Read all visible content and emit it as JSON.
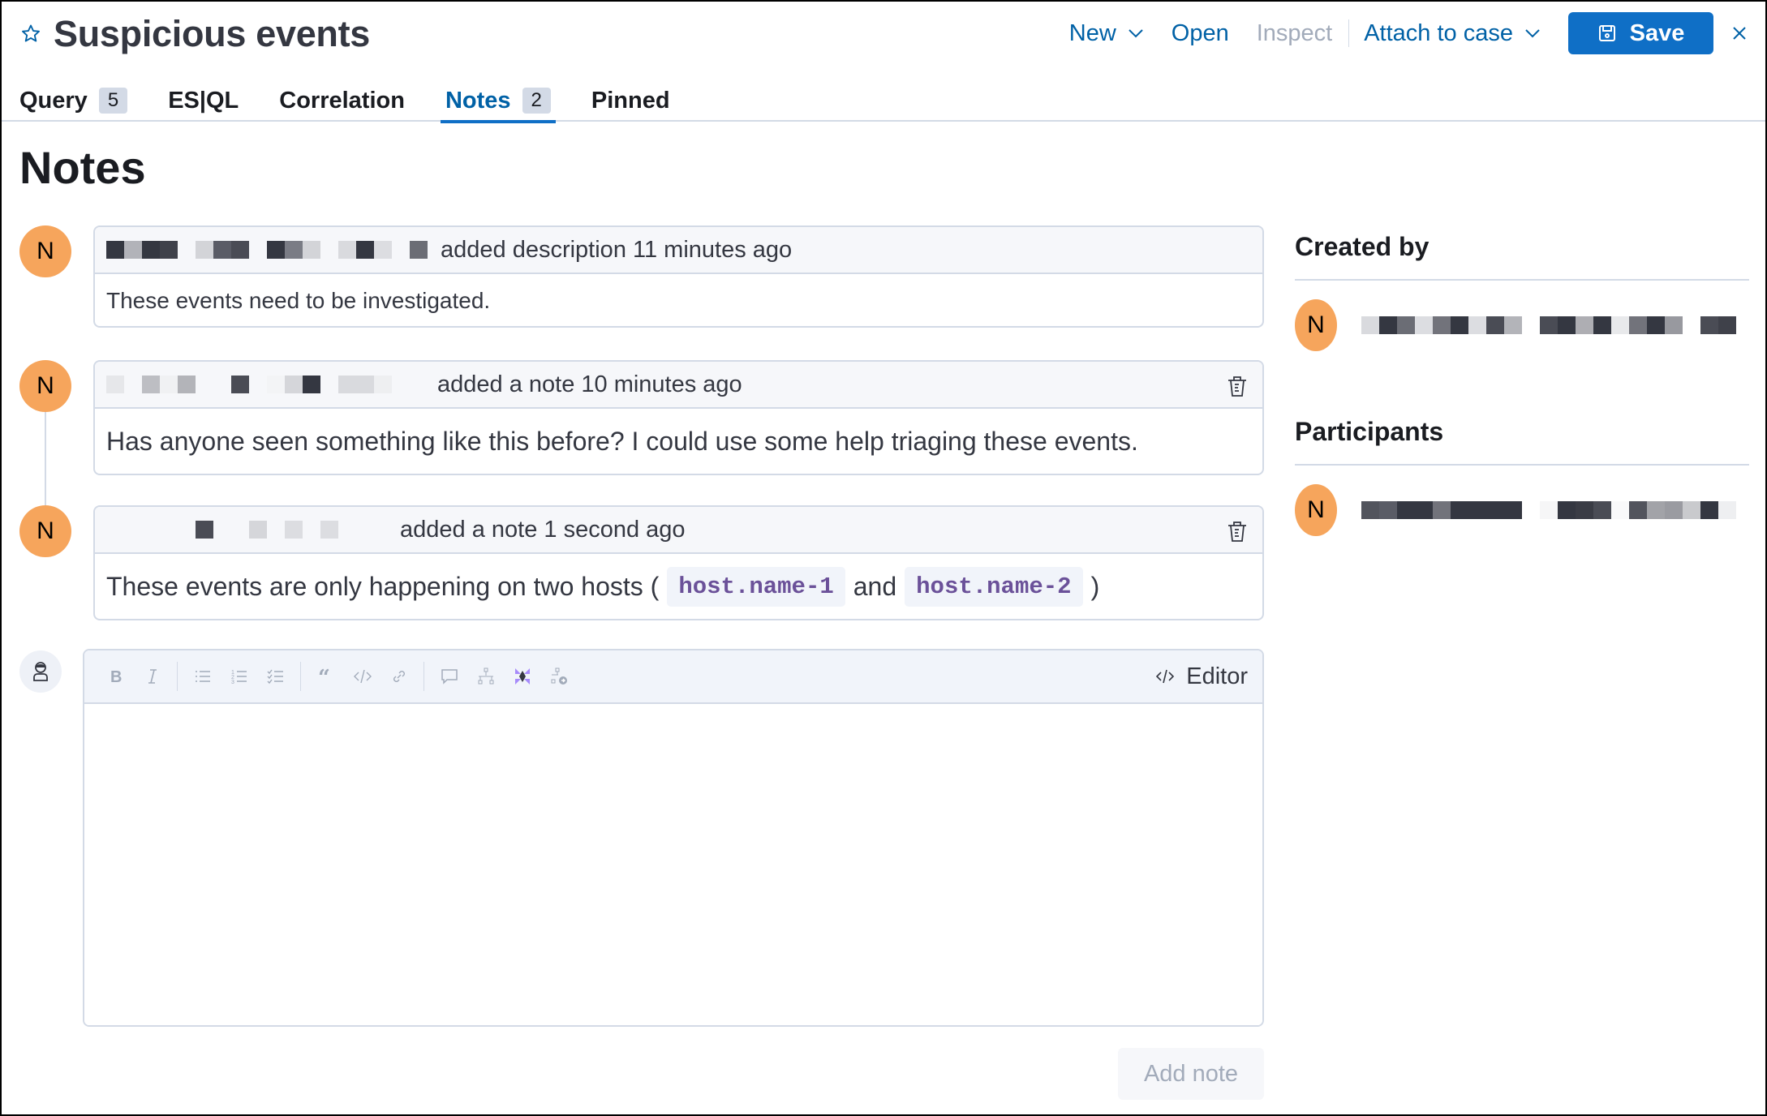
{
  "header": {
    "title": "Suspicious events",
    "actions": {
      "new": "New",
      "open": "Open",
      "inspect": "Inspect",
      "attach": "Attach to case",
      "save": "Save"
    }
  },
  "tabs": [
    {
      "label": "Query",
      "count": "5"
    },
    {
      "label": "ES|QL"
    },
    {
      "label": "Correlation"
    },
    {
      "label": "Notes",
      "count": "2",
      "active": true
    },
    {
      "label": "Pinned"
    }
  ],
  "main": {
    "page_title": "Notes",
    "notes": [
      {
        "avatar": "N",
        "user": "[redacted]",
        "action": "added description 11 minutes ago",
        "text": "These events need to be investigated.",
        "deletable": false
      },
      {
        "avatar": "N",
        "user": "[redacted]",
        "action": "added a note 10 minutes ago",
        "text": "Has anyone seen something like this before? I could use some help triaging these events.",
        "deletable": true
      },
      {
        "avatar": "N",
        "user": "[redacted]",
        "action": "added a note 1 second ago",
        "text_parts": {
          "before": "These events are only happening on two hosts (",
          "code1": "host.name-1",
          "middle": "and",
          "code2": "host.name-2",
          "after": ")"
        },
        "deletable": true
      }
    ],
    "editor": {
      "toolbar": [
        "bold",
        "italic",
        "unordered-list",
        "ordered-list",
        "task-list",
        "quote",
        "code",
        "link",
        "comment",
        "timeline",
        "ai-assistant",
        "insight"
      ],
      "mode_toggle": "Editor",
      "value": "",
      "submit": "Add note"
    }
  },
  "sidebar": {
    "created_by": {
      "heading": "Created by",
      "avatar": "N",
      "name": "[redacted]"
    },
    "participants": {
      "heading": "Participants",
      "items": [
        {
          "avatar": "N",
          "name": "[redacted]"
        }
      ]
    }
  },
  "colors": {
    "accent": "#0f6fc6",
    "link": "#0061a6",
    "avatar": "#f6a55c",
    "code_text": "#6b5199",
    "border": "#d3dae6"
  }
}
